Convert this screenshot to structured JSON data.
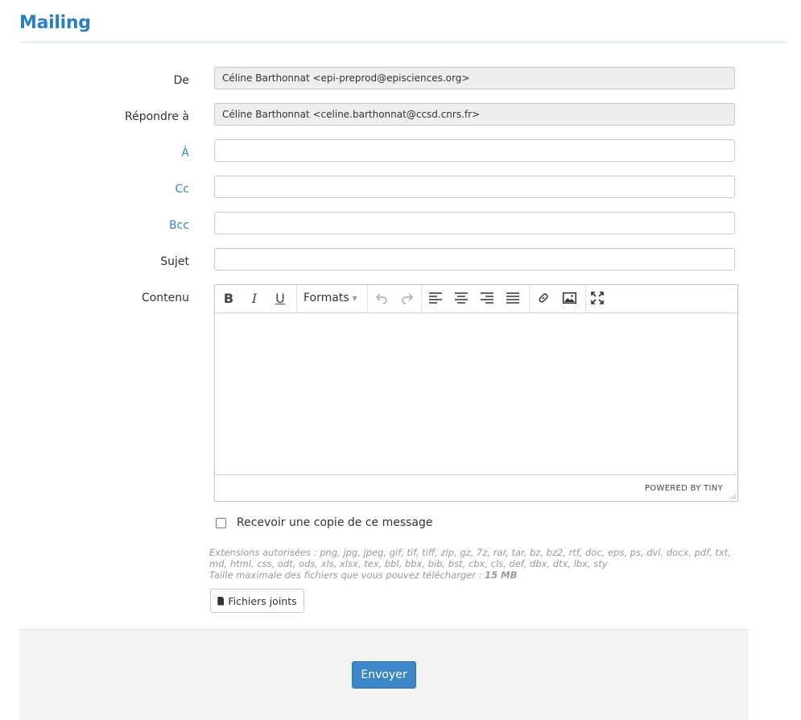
{
  "page": {
    "title": "Mailing"
  },
  "form": {
    "from": {
      "label": "De",
      "value": "Céline Barthonnat <epi-preprod@episciences.org>"
    },
    "reply_to": {
      "label": "Répondre à",
      "value": "Céline Barthonnat <celine.barthonnat@ccsd.cnrs.fr>"
    },
    "to": {
      "label": "À",
      "value": ""
    },
    "cc": {
      "label": "Cc",
      "value": ""
    },
    "bcc": {
      "label": "Bcc",
      "value": ""
    },
    "subject": {
      "label": "Sujet",
      "value": ""
    },
    "content": {
      "label": "Contenu"
    }
  },
  "editor": {
    "toolbar": {
      "bold": "B",
      "italic": "I",
      "underline": "U",
      "formats": "Formats",
      "icons": [
        "bold-icon",
        "italic-icon",
        "underline-icon",
        "undo-icon",
        "redo-icon",
        "align-left-icon",
        "align-center-icon",
        "align-right-icon",
        "align-justify-icon",
        "link-icon",
        "image-icon",
        "fullscreen-icon"
      ]
    },
    "powered_by": "POWERED BY TINY"
  },
  "copy_checkbox": {
    "label": "Recevoir une copie de ce message",
    "checked": false
  },
  "help": {
    "extensions": "Extensions autorisées : png, jpg, jpeg, gif, tif, tiff, zip, gz, 7z, rar, tar, bz, bz2, rtf, doc, eps, ps, dvi, docx, pdf, txt, md, html, css, odt, ods, xls, xlsx, tex, bbl, bbx, bib, bst, cbx, cls, def, dbx, dtx, lbx, sty",
    "max_size_prefix": "Taille maximale des fichiers que vous pouvez télécharger :",
    "max_size_value": "15 MB"
  },
  "attachments_button": "Fichiers joints",
  "send_button": "Envoyer",
  "colors": {
    "accent": "#2a7fc0",
    "primary_button": "#3b87c8"
  }
}
